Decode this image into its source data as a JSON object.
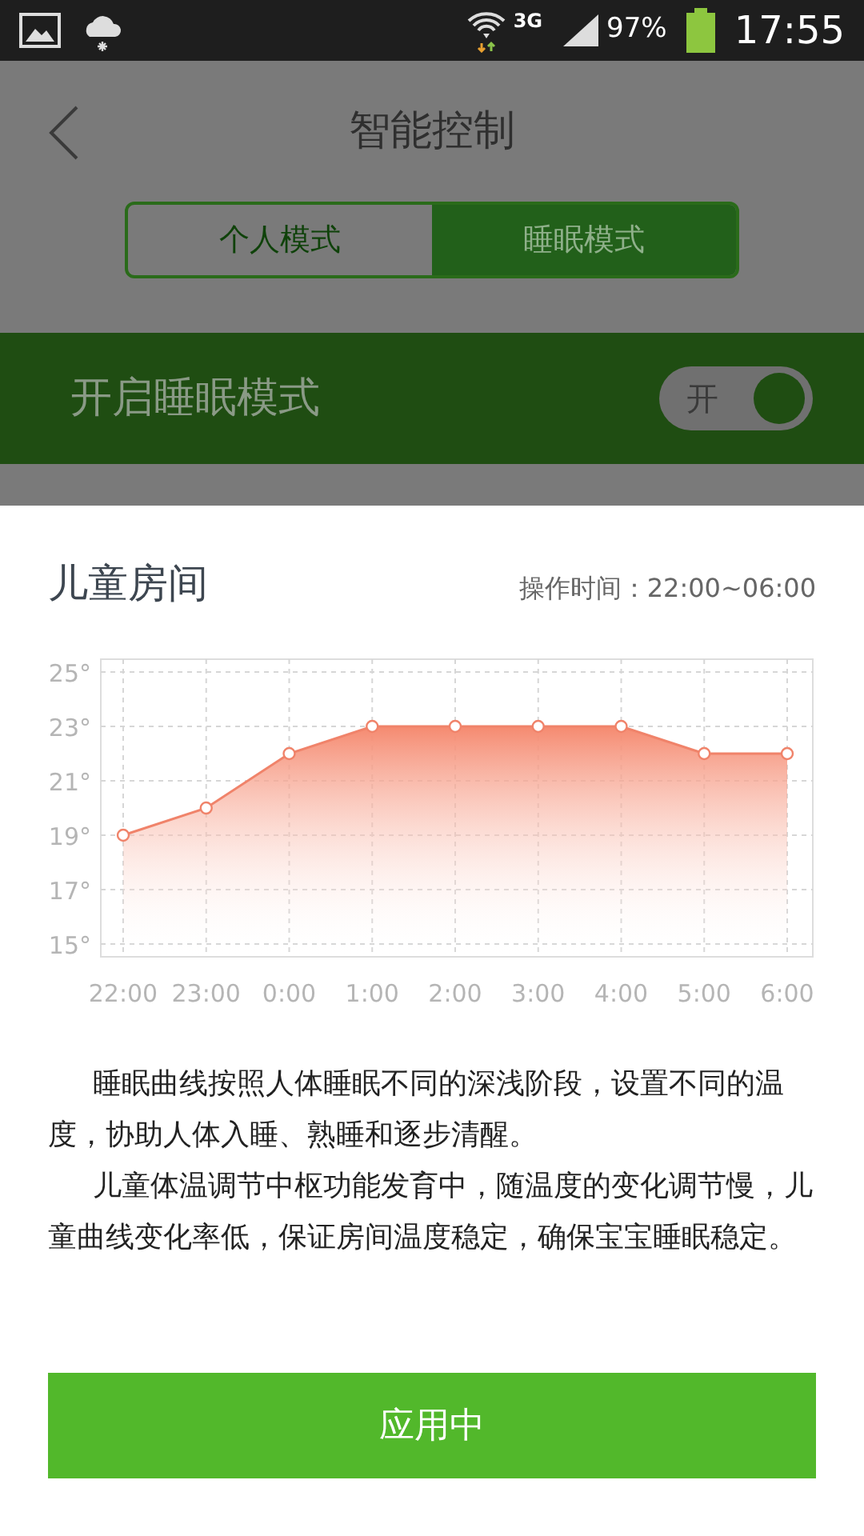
{
  "status_bar": {
    "network": "3G",
    "battery": "97%",
    "time": "17:55"
  },
  "header": {
    "title": "智能控制"
  },
  "tabs": [
    {
      "label": "个人模式",
      "selected": false
    },
    {
      "label": "睡眠模式",
      "selected": true
    }
  ],
  "sleep_mode": {
    "label": "开启睡眠模式",
    "toggle_text": "开",
    "on": true
  },
  "room": {
    "title": "儿童房间",
    "schedule": "操作时间：22:00~06:00",
    "chart_data": {
      "type": "area",
      "categories": [
        "22:00",
        "23:00",
        "0:00",
        "1:00",
        "2:00",
        "3:00",
        "4:00",
        "5:00",
        "6:00"
      ],
      "grid": true,
      "series": [
        {
          "color": "#f0836a",
          "values": [
            19,
            20,
            22,
            23,
            23,
            23,
            23,
            22,
            22
          ]
        }
      ],
      "ylim": [
        15,
        25
      ],
      "yticks": [
        {
          "value": 25,
          "label": "25°"
        },
        {
          "value": 23,
          "label": "23°"
        },
        {
          "value": 21,
          "label": "21°"
        },
        {
          "value": 19,
          "label": "19°"
        },
        {
          "value": 17,
          "label": "17°"
        },
        {
          "value": 15,
          "label": "15°"
        }
      ]
    },
    "paragraphs": [
      "睡眠曲线按照人体睡眠不同的深浅阶段，设置不同的温度，协助人体入睡、熟睡和逐步清醒。",
      "儿童体温调节中枢功能发育中，随温度的变化调节慢，儿童曲线变化率低，保证房间温度稳定，确保宝宝睡眠稳定。"
    ],
    "apply_button": "应用中"
  }
}
